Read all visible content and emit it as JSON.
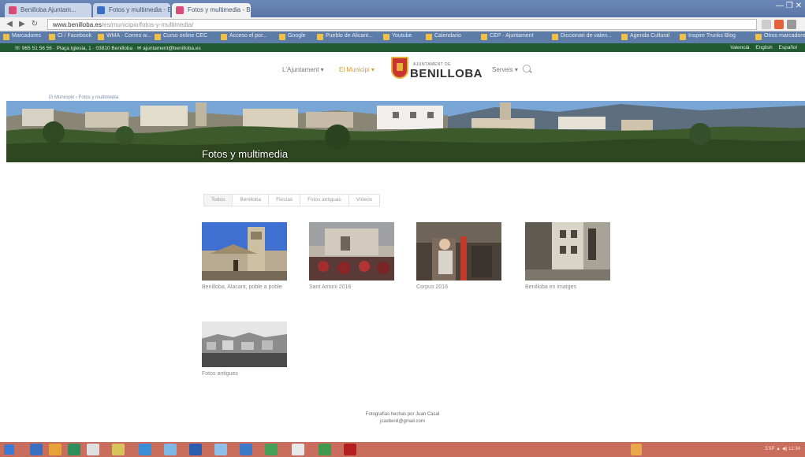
{
  "browser": {
    "tabs": [
      {
        "label": "Benilloba Ajuntam..."
      },
      {
        "label": "Fotos y multimedia - Be..."
      },
      {
        "label": "Fotos y multimedia - Be..."
      }
    ],
    "window_controls": "— ❐ ✕",
    "url_domain": "www.benilloba.es",
    "url_path": "/es/municipio/fotos-y-multimedia/",
    "bookmarks": [
      "Marcadores",
      "Cl / Facebook",
      "WMA · Correo w...",
      "Curso online CEC",
      "Acceso el por...",
      "Google",
      "Pueblo de Alicant...",
      "Youtube",
      "Calendario",
      "CEP · Ajuntament",
      "Diccionari de valen...",
      "Agenda Cultural",
      "Inspire Trunks Blog",
      "Otros marcadores"
    ]
  },
  "site": {
    "topbar": {
      "contact": "☏ 965 51 56 56 · Plaça Iglesia, 1 · 03810 Benilloba · ✉ ajuntament@benilloba.es",
      "languages": [
        "Valencià",
        "English",
        "Español"
      ]
    },
    "nav": {
      "left": [
        "L'Ajuntament ▾",
        "El Municipi ▾"
      ],
      "right": [
        "Serveis ▾"
      ],
      "logo_small": "AJUNTAMENT DE",
      "logo_big": "BENILLOBA"
    },
    "breadcrumb": "El Municipio › Fotos y multimedia",
    "banner_title": "Fotos y multimedia",
    "filters": [
      "Todos",
      "Benilloba",
      "Fiestas",
      "Fotos antiguas",
      "Vídeos"
    ],
    "gallery": [
      {
        "caption": "Benilloba, Alacant, poble a poble"
      },
      {
        "caption": "Sant Antoni 2016"
      },
      {
        "caption": "Corpus 2016"
      },
      {
        "caption": "Benilloba en imatges"
      },
      {
        "caption": "Fotos antigues"
      }
    ],
    "footer": {
      "line1": "Fotografías hechas por Juan Casal",
      "line2": "jcasbenil@gmail.com"
    }
  },
  "taskbar": {
    "tray_text": "ESP  ▲  ◀)  12:34"
  }
}
